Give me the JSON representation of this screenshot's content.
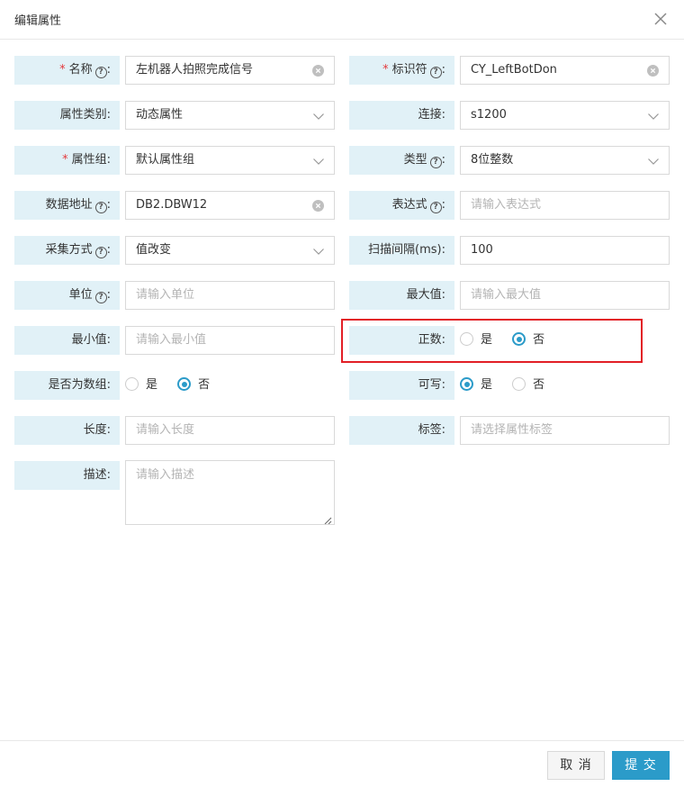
{
  "dialog": {
    "title": "编辑属性"
  },
  "form": {
    "name": {
      "label": "名称",
      "value": "左机器人拍照完成信号",
      "required": true
    },
    "identifier": {
      "label": "标识符",
      "value": "CY_LeftBotDon",
      "required": true
    },
    "attr_category": {
      "label": "属性类别",
      "value": "动态属性"
    },
    "connection": {
      "label": "连接",
      "value": "s1200"
    },
    "attr_group": {
      "label": "属性组",
      "value": "默认属性组",
      "required": true
    },
    "type": {
      "label": "类型",
      "value": "8位整数"
    },
    "data_address": {
      "label": "数据地址",
      "value": "DB2.DBW12"
    },
    "expression": {
      "label": "表达式",
      "placeholder": "请输入表达式"
    },
    "collect_mode": {
      "label": "采集方式",
      "value": "值改变"
    },
    "scan_interval": {
      "label": "扫描间隔(ms)",
      "value": "100"
    },
    "unit": {
      "label": "单位",
      "placeholder": "请输入单位"
    },
    "max_value": {
      "label": "最大值",
      "placeholder": "请输入最大值"
    },
    "min_value": {
      "label": "最小值",
      "placeholder": "请输入最小值"
    },
    "positive": {
      "label": "正数",
      "options": [
        "是",
        "否"
      ],
      "selected": "否"
    },
    "is_array": {
      "label": "是否为数组",
      "options": [
        "是",
        "否"
      ],
      "selected": "否"
    },
    "writable": {
      "label": "可写",
      "options": [
        "是",
        "否"
      ],
      "selected": "是"
    },
    "length": {
      "label": "长度",
      "placeholder": "请输入长度"
    },
    "tags": {
      "label": "标签",
      "placeholder": "请选择属性标签"
    },
    "description": {
      "label": "描述",
      "placeholder": "请输入描述"
    }
  },
  "footer": {
    "cancel_label": "取 消",
    "submit_label": "提 交"
  },
  "colors": {
    "accent": "#2b9bc9",
    "label_bg": "#e1f1f7",
    "highlight": "#e21f26",
    "required": "#e4393c"
  }
}
